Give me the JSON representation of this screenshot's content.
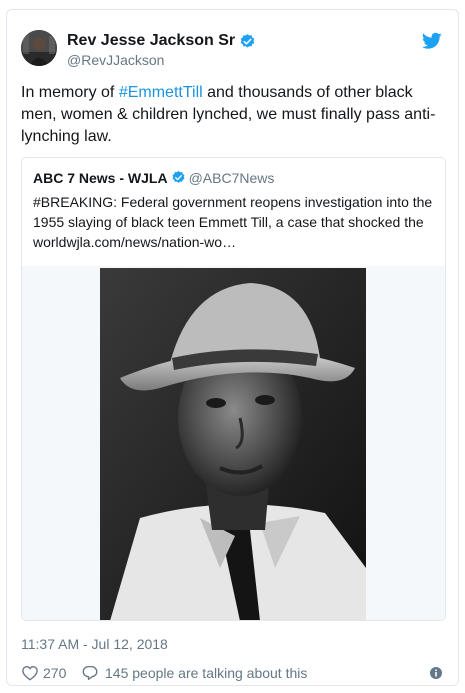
{
  "author": {
    "display_name": "Rev Jesse Jackson Sr",
    "handle": "@RevJJackson",
    "verified": true
  },
  "tweet": {
    "text_before": "In memory of ",
    "hashtag": "#EmmettTill",
    "text_after": " and thousands of other black men, women & children lynched, we must finally pass anti-lynching law."
  },
  "quoted": {
    "display_name": "ABC 7 News - WJLA",
    "handle": "@ABC7News",
    "verified": true,
    "text": "#BREAKING: Federal government reopens investigation into the 1955 slaying of black teen Emmett Till, a case that shocked the worldwjla.com/news/nation-wo…"
  },
  "meta": {
    "timestamp": "11:37 AM - Jul 12, 2018",
    "likes": "270",
    "talking": "145 people are talking about this"
  },
  "colors": {
    "link": "#1b95e0",
    "secondary_text": "#657786",
    "border": "#e1e8ed",
    "verified_blue": "#1da1f2"
  },
  "icons": [
    "twitter-bird-icon",
    "verified-badge-icon",
    "heart-icon",
    "reply-icon",
    "info-icon"
  ]
}
